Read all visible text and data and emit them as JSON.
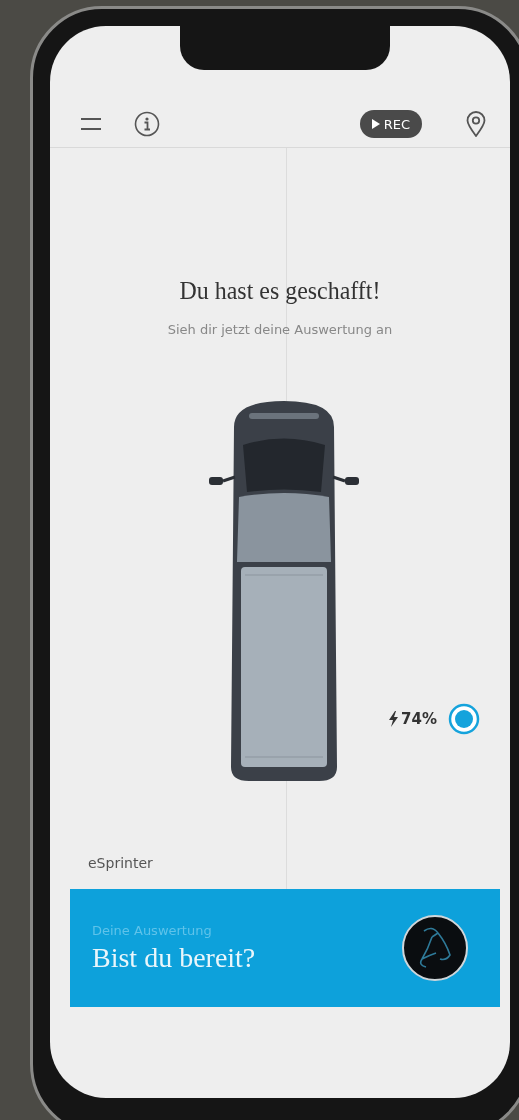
{
  "header": {
    "rec_button": {
      "label": "REC"
    }
  },
  "intro": {
    "title": "Du hast es geschafft!",
    "subtitle": "Sieh dir jetzt deine Auswertung an"
  },
  "vehicle": {
    "name": "eSprinter",
    "battery": "74%"
  },
  "card": {
    "label": "Deine Auswertung",
    "title": "Bist du bereit?"
  }
}
